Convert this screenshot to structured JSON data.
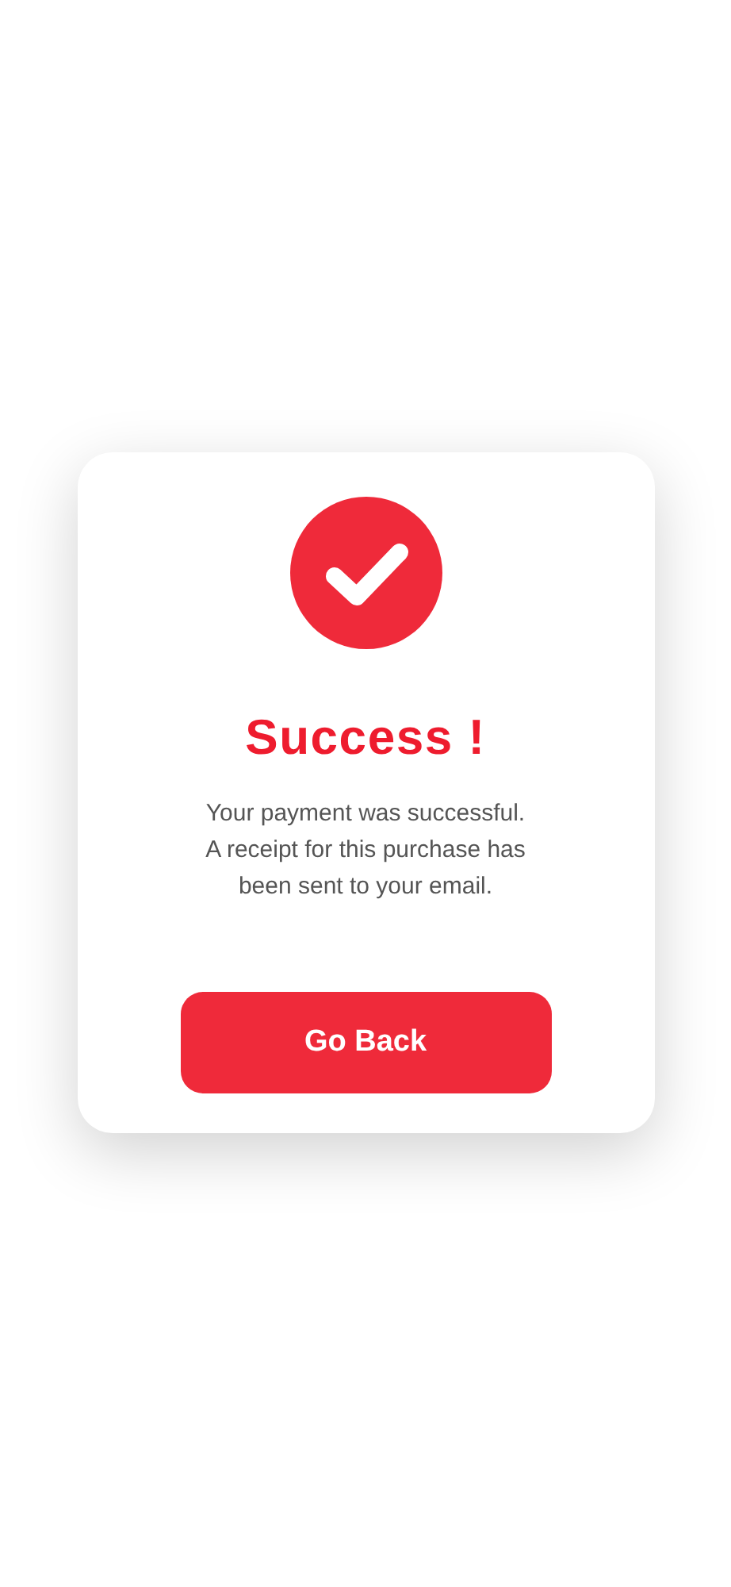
{
  "dialog": {
    "title": "Success !",
    "message": "Your payment was successful.\nA receipt for this purchase has\nbeen sent to your email.",
    "button": "Go Back"
  }
}
